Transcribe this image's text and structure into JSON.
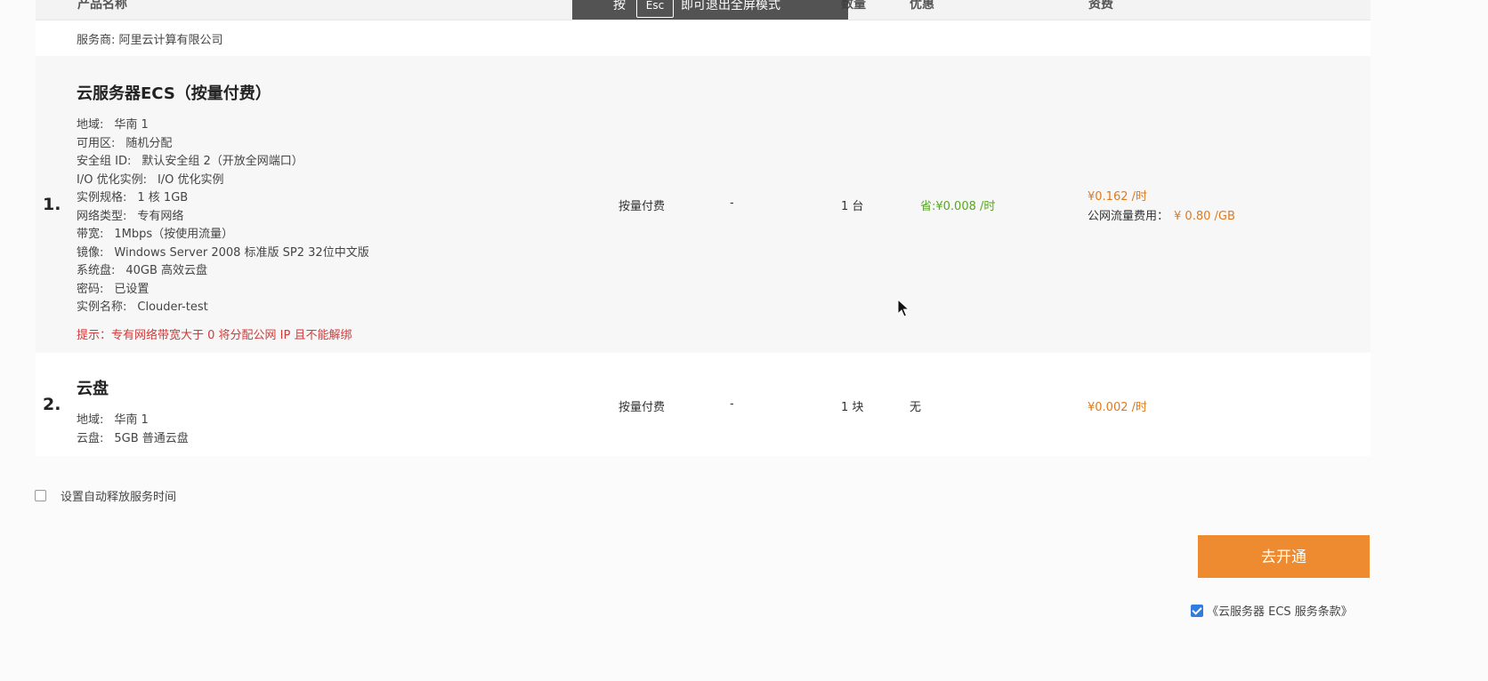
{
  "table_header": {
    "product": "产品名称",
    "quantity": "数量",
    "discount": "优惠",
    "fee": "资费"
  },
  "fullscreen_hint": {
    "prefix": "按",
    "key": "Esc",
    "suffix": "即可退出全屏模式"
  },
  "provider": "服务商: 阿里云计算有限公司",
  "items": [
    {
      "index": "1.",
      "title": "云服务器ECS（按量付费）",
      "specs": [
        {
          "key": "地域:",
          "value": "华南 1"
        },
        {
          "key": "可用区:",
          "value": "随机分配"
        },
        {
          "key": "安全组 ID:",
          "value": "默认安全组 2（开放全网端口）"
        },
        {
          "key": "I/O 优化实例:",
          "value": "I/O 优化实例"
        },
        {
          "key": "实例规格:",
          "value": "1 核 1GB"
        },
        {
          "key": "网络类型:",
          "value": "专有网络"
        },
        {
          "key": "带宽:",
          "value": "1Mbps（按使用流量）"
        },
        {
          "key": "镜像:",
          "value": "Windows Server 2008 标准版 SP2 32位中文版"
        },
        {
          "key": "系统盘:",
          "value": "40GB 高效云盘"
        },
        {
          "key": "密码:",
          "value": "已设置"
        },
        {
          "key": "实例名称:",
          "value": "Clouder-test"
        }
      ],
      "tip_label": "提示：",
      "tip": "专有网络带宽大于 0 将分配公网 IP 且不能解绑",
      "billing": "按量付费",
      "period": "-",
      "quantity": "1 台",
      "discount": "省:¥0.008 /时",
      "fee": "¥0.162 /时",
      "traffic_label": "公网流量费用：",
      "traffic_value": "¥ 0.80 /GB"
    },
    {
      "index": "2.",
      "title": "云盘",
      "specs": [
        {
          "key": "地域:",
          "value": "华南 1"
        },
        {
          "key": "云盘:",
          "value": "5GB 普通云盘"
        }
      ],
      "billing": "按量付费",
      "period": "-",
      "quantity": "1 块",
      "discount": "无",
      "fee": "¥0.002 /时"
    }
  ],
  "auto_release": {
    "label": "设置自动释放服务时间",
    "checked": false
  },
  "submit_label": "去开通",
  "terms": {
    "label": "《云服务器 ECS 服务条款》",
    "checked": true
  },
  "colors": {
    "accent_orange": "#ee8a2f",
    "price_orange": "#e07a1e",
    "discount_green": "#58a623",
    "tip_red": "#d03a3a",
    "checkbox_blue": "#2f7ddf"
  }
}
